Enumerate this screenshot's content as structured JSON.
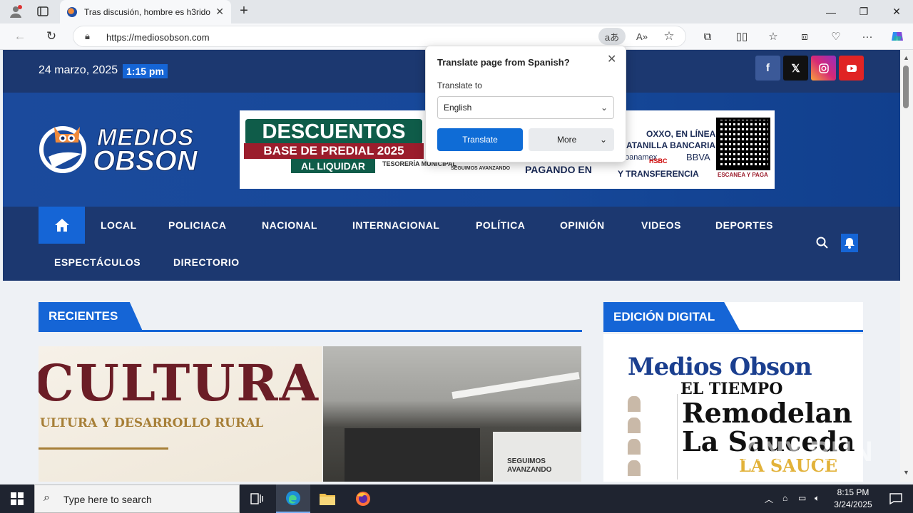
{
  "browser": {
    "tab_title": "Tras discusión, hombre es h3rido",
    "url": "https://mediosobson.com"
  },
  "site": {
    "date": "24 marzo, 2025",
    "time": "1:15 pm",
    "logo_line1": "MEDIOS",
    "logo_line2": "OBSON",
    "social": [
      "facebook-icon",
      "x-icon",
      "instagram-icon",
      "youtube-icon"
    ],
    "banner": {
      "line1": "DESCUENTOS",
      "line2": "BASE DE PREDIAL 2025",
      "line3": "AL LIQUIDAR",
      "tesoreria": "TESORERÍA MUNICIPAL",
      "seguimos": "SEGUIMOS AVANZANDO",
      "pagando": "PAGANDO EN",
      "oxxo": "OXXO, EN LÍNEA,",
      "ventanilla": "ATANILLA BANCARIA,",
      "banamex": "banamex",
      "bbva": "BBVA",
      "hsbc": "HSBC",
      "transferencia": "Y TRANSFERENCIA",
      "escanea": "ESCANEA Y PAGA"
    },
    "nav": {
      "row1": [
        "LOCAL",
        "POLICIACA",
        "NACIONAL",
        "INTERNACIONAL",
        "POLÍTICA",
        "OPINIÓN",
        "VIDEOS",
        "DEPORTES"
      ],
      "row2": [
        "ESPECTÁCULOS",
        "DIRECTORIO"
      ]
    },
    "recientes_label": "RECIENTES",
    "edicion_label": "EDICIÓN DIGITAL",
    "img1": {
      "big": "CULTURA",
      "sub": "ULTURA Y DESARROLLO RURAL"
    },
    "img2": {
      "sign": "SEGUIMOS AVANZANDO"
    },
    "paper": {
      "masthead": "Medios Obson",
      "subtitle": "EL TIEMPO",
      "headline1": "Remodelan",
      "headline2": "La Sauceda",
      "headline3": "LA SAUCE"
    }
  },
  "translate_popup": {
    "title": "Translate page from Spanish?",
    "label": "Translate to",
    "selected": "English",
    "translate_btn": "Translate",
    "more_btn": "More"
  },
  "taskbar": {
    "search_placeholder": "Type here to search",
    "time": "8:15 PM",
    "date": "3/24/2025"
  },
  "watermark": "ANY.RUN",
  "colors": {
    "navy": "#1c3870",
    "accent_blue": "#1565d6",
    "translate_blue": "#0f6cd6"
  }
}
